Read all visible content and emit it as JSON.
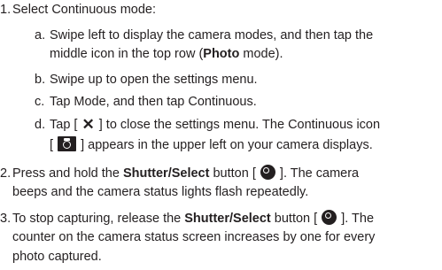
{
  "steps": [
    {
      "number": "1.",
      "text": "Select Continuous mode:",
      "substeps": [
        {
          "letter": "a.",
          "line1": "Swipe left to display the camera modes, and then tap the",
          "line2_before": "middle icon in the top row (",
          "line2_bold": "Photo",
          "line2_after": " mode)."
        },
        {
          "letter": "b.",
          "text": "Swipe up to open the settings menu."
        },
        {
          "letter": "c.",
          "text": "Tap Mode, and then tap Continuous."
        },
        {
          "letter": "d.",
          "line1_before": "Tap [",
          "close_glyph": "✕",
          "line1_after": "] to close the settings menu. The Continuous icon",
          "line2_before": "[",
          "line2_after": "] appears in the upper left on your camera displays."
        }
      ]
    },
    {
      "number": "2.",
      "line1_before": "Press and hold the ",
      "line1_bold": "Shutter/Select",
      "line1_after_button": " button [",
      "line1_end": "]. The camera",
      "line2": "beeps and the camera status lights flash repeatedly."
    },
    {
      "number": "3.",
      "line1_before": "To stop capturing, release the ",
      "line1_bold": "Shutter/Select",
      "line1_after_button": " button [",
      "line1_end": "]. The",
      "line2": "counter on the camera status screen increases by one for every",
      "line3": "photo captured."
    }
  ],
  "icons": {
    "close": "close-icon",
    "continuous": "continuous-mode-icon",
    "shutter": "shutter-button-icon"
  }
}
